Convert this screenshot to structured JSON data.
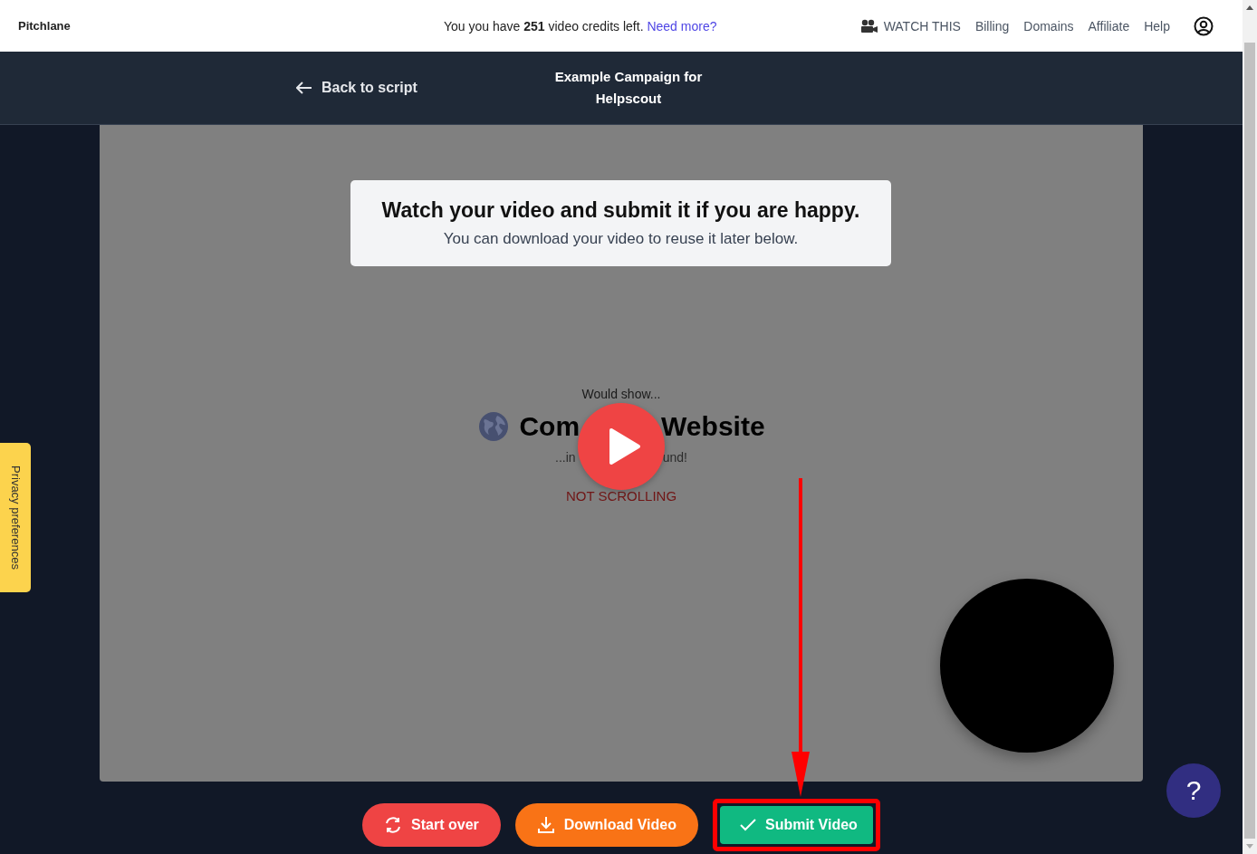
{
  "header": {
    "brand": "Pitchlane",
    "credits": {
      "before": "You you have ",
      "count": "251",
      "after": " video credits left.",
      "link": "Need more?"
    },
    "nav": [
      {
        "label": "WATCH THIS",
        "kind": "video"
      },
      {
        "label": "Billing",
        "kind": "link"
      },
      {
        "label": "Domains",
        "kind": "link"
      },
      {
        "label": "Affiliate",
        "kind": "link"
      },
      {
        "label": "Help",
        "kind": "link"
      }
    ]
  },
  "subheader": {
    "back": "Back to script",
    "title": [
      "Example Campaign for",
      "Helpscout"
    ]
  },
  "notice": {
    "title": "Watch your video and submit it if you are happy.",
    "text": "You can download your video to reuse it later below."
  },
  "preview": {
    "intro": "Would show...",
    "heading_left": "Com",
    "heading_right": "Website",
    "sub_left": "...in",
    "sub_right": "und!",
    "status": "NOT SCROLLING"
  },
  "privacy_tab": "Privacy preferences",
  "buttons": [
    {
      "label": "Start over",
      "kind": "restart",
      "highlighted": false
    },
    {
      "label": "Download Video",
      "kind": "download",
      "highlighted": false
    },
    {
      "label": "Submit Video",
      "kind": "submit",
      "highlighted": true
    }
  ],
  "help_button": "?"
}
